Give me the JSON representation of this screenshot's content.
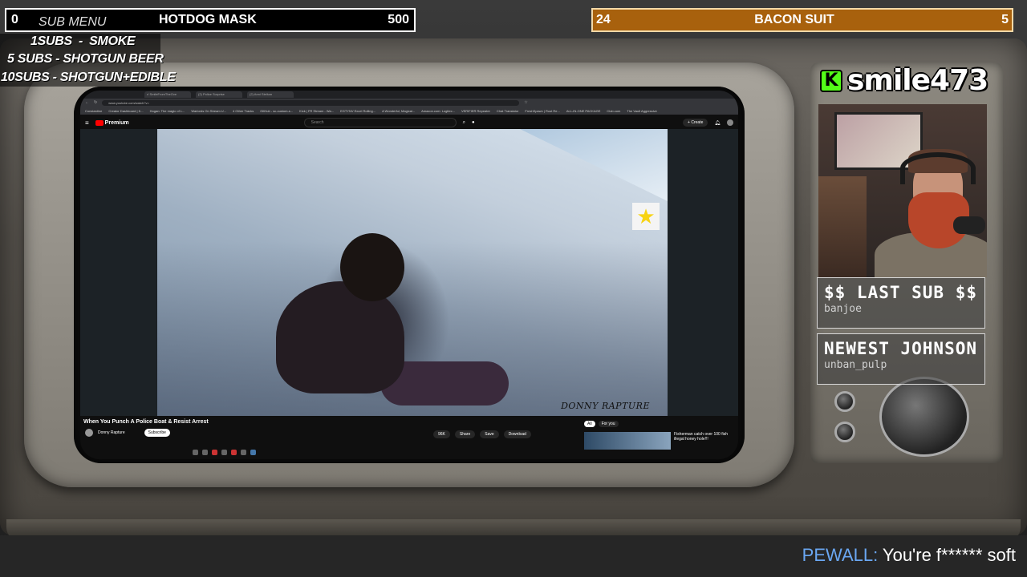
{
  "top_bar_left": {
    "counter": "0",
    "menu_label": "SUB MENU",
    "item": "HOTDOG MASK",
    "value": "500"
  },
  "top_bar_right": {
    "left": "24",
    "item": "BACON SUIT",
    "right": "5",
    "color": "#a8610d"
  },
  "sub_menu": [
    "1SUBS   - SMOKE",
    "5 SUBS  - SHOTGUN BEER",
    "10SUBS - SHOTGUN+EDIBLE"
  ],
  "browser": {
    "tabs": [
      "r/ SmileFromTheOve",
      "(2) Police Surprise",
      "(2) Anni Stellum"
    ],
    "url": "www.youtube.com/watch?v=",
    "bookmarks": [
      "Constantine",
      "Creator Dashboard | K...",
      "Hogan: The magic of L...",
      "Warlords On Stream U...",
      "4 Other Tracks",
      "GitHub - sc-custom-s...",
      "Kick | FR Stream - Wa...",
      "EGTYNV Excel Rolling...",
      "A Wonderful, Magical...",
      "Amazon.com: Logitec...",
      "VERIFIER Repeater",
      "Chat Translator",
      "FreshSpawn | Rust Re...",
      "ALL-IN-ONE PACKAGE",
      "Club.com",
      "The Vault Aggressive"
    ]
  },
  "youtube": {
    "logo": "Premium",
    "search_placeholder": "Search",
    "create": "+ Create",
    "video_title": "When You Punch A Police Boat & Resist Arrest",
    "channel": "Donny Rapture",
    "subscribe": "Subscribe",
    "actions": [
      "96K",
      "Share",
      "Save",
      "Download"
    ],
    "watermark": "DONNY RAPTURE",
    "rec_chips": [
      "All",
      "For you"
    ],
    "rec_title": "Fisherman catch over 100 fish illegal honey hole!!!"
  },
  "streamer": {
    "platform_logo": "K",
    "username": "smile473"
  },
  "last_sub": {
    "title": "$$ LAST SUB $$",
    "value": "banjoe"
  },
  "newest": {
    "title": "NEWEST JOHNSON",
    "value": "unban_pulp"
  },
  "chat": {
    "user": "PEWALL:",
    "message": " You're f****** soft"
  }
}
